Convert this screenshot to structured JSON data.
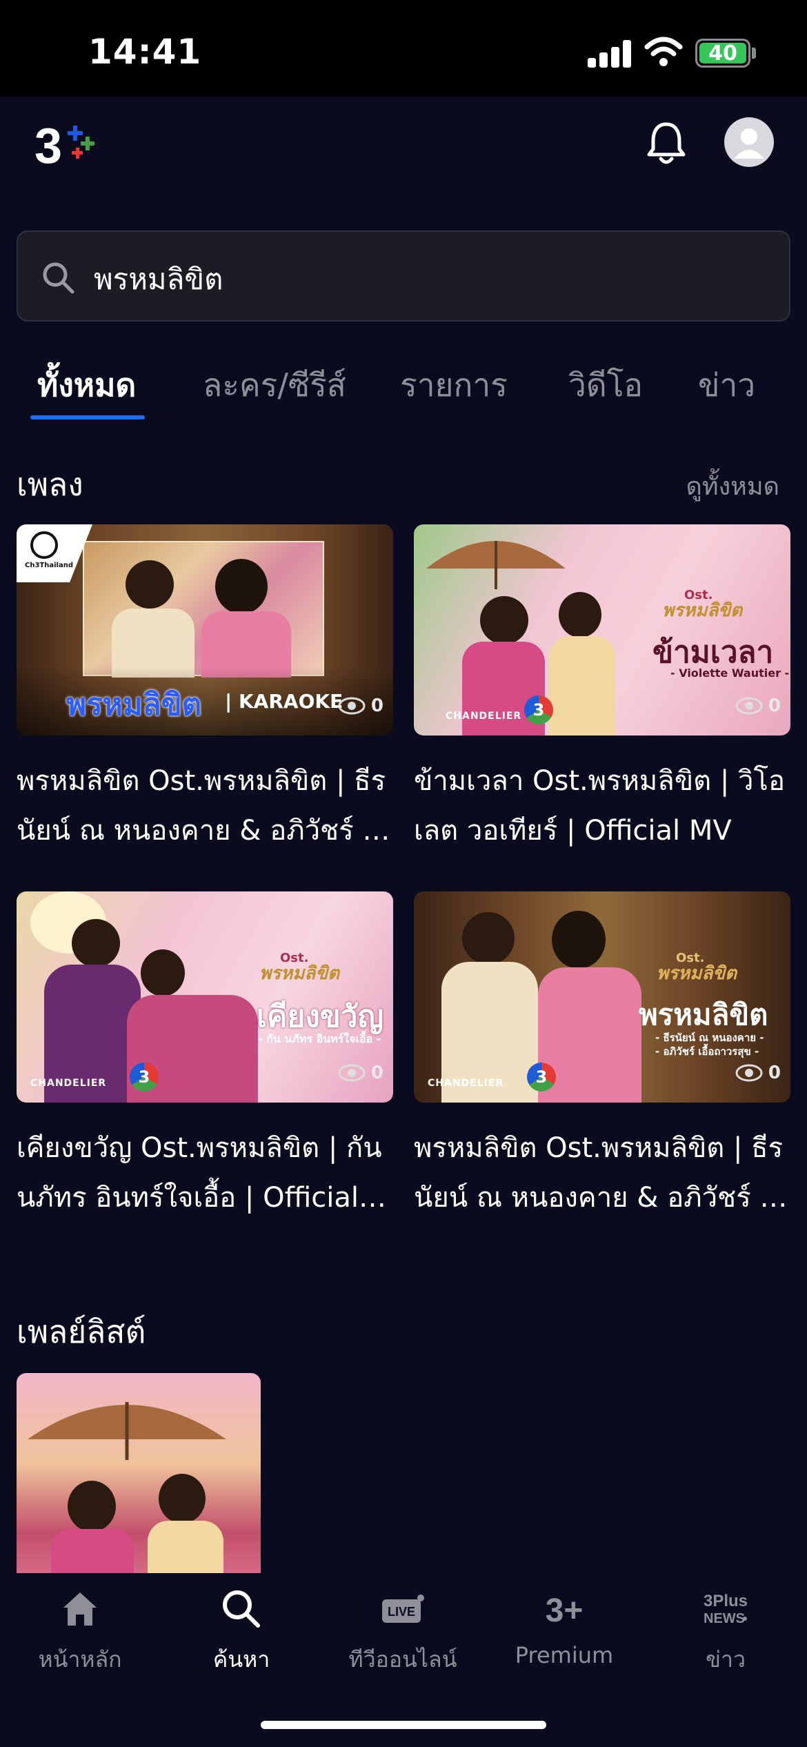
{
  "status_bar": {
    "time": "14:41",
    "battery": "40"
  },
  "header": {
    "logo": "3+",
    "notification_icon": "bell-icon",
    "profile_icon": "avatar-icon"
  },
  "search": {
    "value": "พรหมลิขิต",
    "icon": "search-icon"
  },
  "tabs": [
    {
      "label": "ทั้งหมด",
      "active": true
    },
    {
      "label": "ละคร/ซีรีส์"
    },
    {
      "label": "รายการ"
    },
    {
      "label": "วิดีโอ"
    },
    {
      "label": "ข่าว"
    }
  ],
  "songs_section": {
    "title": "เพลง",
    "see_all": "ดูทั้งหมด",
    "items": [
      {
        "thumb_title": "พรหมลิขิต",
        "thumb_tag": "| KARAOKE",
        "views": "0",
        "title_line1": "พรหมลิขิต Ost.พรหมลิขิต | ธีร",
        "title_line2": "นัยน์ ณ หนองคาย & อภิวัชร์ เอื้..."
      },
      {
        "thumb_title": "ข้ามเวลา",
        "thumb_sub": "- Violette Wautier -",
        "thumb_ost": "Ost.",
        "thumb_logo": "พรหมลิขิต",
        "views": "0",
        "title_line1": "ข้ามเวลา Ost.พรหมลิขิต | วิโอ",
        "title_line2": "เลต วอเทียร์ | Official MV"
      },
      {
        "thumb_title": "เคียงขวัญ",
        "thumb_sub": "- กัน นภัทร อินทร์ใจเอื้อ -",
        "thumb_ost": "Ost.",
        "thumb_logo": "พรหมลิขิต",
        "views": "0",
        "title_line1": "เคียงขวัญ Ost.พรหมลิขิต | กัน",
        "title_line2": "นภัทร อินทร์ใจเอื้อ | Official MV"
      },
      {
        "thumb_title": "พรหมลิขิต",
        "thumb_sub": "- ธีรนัยน์ ณ หนองคาย -",
        "thumb_sub2": "- อภิวัชร์ เอื้อถาวรสุข -",
        "thumb_ost": "Ost.",
        "thumb_logo": "พรหมลิขิต",
        "views": "0",
        "title_line1": "พรหมลิขิต Ost.พรหมลิขิต | ธีร",
        "title_line2": "นัยน์ ณ หนองคาย & อภิวัชร์ เอื้..."
      }
    ],
    "badge_ch3": "3",
    "chandelier": "CHANDELIER",
    "ch3thailand": "Ch3Thailand"
  },
  "playlist_section": {
    "title": "เพลย์ลิสต์"
  },
  "bottom_nav": [
    {
      "label": "หน้าหลัก",
      "icon": "home-icon"
    },
    {
      "label": "ค้นหา",
      "icon": "search-icon",
      "active": true
    },
    {
      "label": "ทีวีออนไลน์",
      "icon": "live-tv-icon",
      "badge": "LIVE"
    },
    {
      "label": "Premium",
      "icon": "premium-icon",
      "badge": "3+"
    },
    {
      "label": "ข่าว",
      "icon": "news-icon",
      "badge_line1": "3Plus",
      "badge_line2": "NEWS"
    }
  ]
}
